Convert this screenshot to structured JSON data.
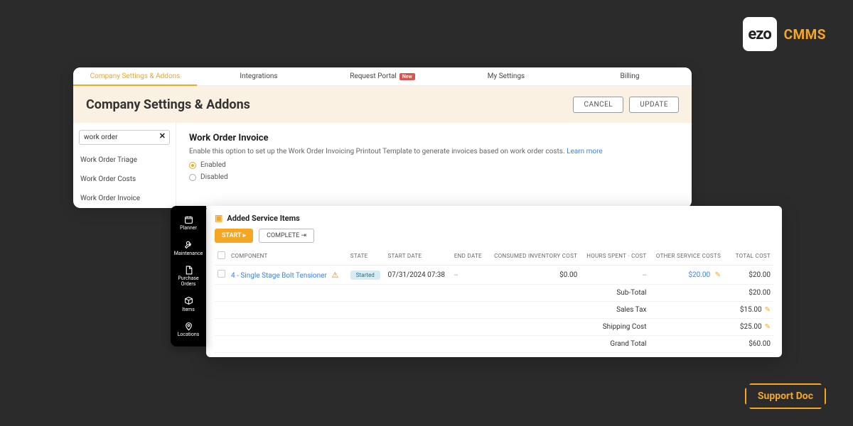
{
  "logo": {
    "mark": "ezo",
    "product": "CMMS"
  },
  "tabs": [
    {
      "label": "Company Settings & Addons",
      "active": true
    },
    {
      "label": "Integrations"
    },
    {
      "label": "Request Portal",
      "badge": "New"
    },
    {
      "label": "My Settings"
    },
    {
      "label": "Billing"
    }
  ],
  "header": {
    "title": "Company Settings & Addons",
    "cancel": "CANCEL",
    "update": "UPDATE"
  },
  "search": {
    "value": "work order"
  },
  "side_items": [
    "Work Order Triage",
    "Work Order Costs",
    "Work Order Invoice"
  ],
  "section": {
    "title": "Work Order Invoice",
    "desc": "Enable this option to set up the Work Order Invoicing Printout Template to generate invoices based on work order costs.",
    "learn": "Learn more",
    "opt_enabled": "Enabled",
    "opt_disabled": "Disabled"
  },
  "nav": [
    {
      "label": "Planner",
      "icon": "calendar"
    },
    {
      "label": "Maintenance",
      "icon": "wrench"
    },
    {
      "label": "Purchase Orders",
      "icon": "doc"
    },
    {
      "label": "Items",
      "icon": "box"
    },
    {
      "label": "Locations",
      "icon": "pin"
    }
  ],
  "service": {
    "title": "Added Service Items",
    "start": "START ▸",
    "complete": "COMPLETE ⇥",
    "cols": [
      "COMPONENT",
      "STATE",
      "START DATE",
      "END DATE",
      "CONSUMED INVENTORY COST",
      "HOURS SPENT · COST",
      "OTHER SERVICE COSTS",
      "TOTAL COST"
    ],
    "row": {
      "component": "4 - Single Stage Bolt Tensioner",
      "state": "Started",
      "start_date": "07/31/2024 07:38",
      "end_date": "--",
      "consumed": "$0.00",
      "hours": "--",
      "other": "$20.00",
      "total": "$20.00"
    },
    "summary": [
      {
        "label": "Sub-Total",
        "value": "$20.00"
      },
      {
        "label": "Sales Tax",
        "value": "$15.00",
        "edit": true
      },
      {
        "label": "Shipping Cost",
        "value": "$25.00",
        "edit": true
      },
      {
        "label": "Grand Total",
        "value": "$60.00"
      }
    ]
  },
  "support": "Support Doc"
}
